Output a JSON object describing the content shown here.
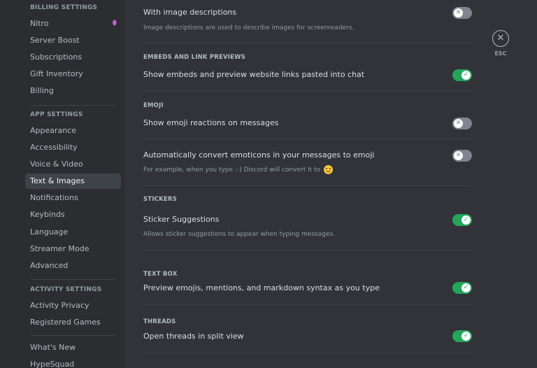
{
  "sidebar": {
    "billing_header": "Billing Settings",
    "billing_items": [
      "Nitro",
      "Server Boost",
      "Subscriptions",
      "Gift Inventory",
      "Billing"
    ],
    "app_header": "App Settings",
    "app_items": [
      "Appearance",
      "Accessibility",
      "Voice & Video",
      "Text & Images",
      "Notifications",
      "Keybinds",
      "Language",
      "Streamer Mode",
      "Advanced"
    ],
    "active_item": "Text & Images",
    "activity_header": "Activity Settings",
    "activity_items": [
      "Activity Privacy",
      "Registered Games"
    ],
    "misc_items": [
      "What's New",
      "HypeSquad"
    ]
  },
  "settings": {
    "image_desc_title": "With image descriptions",
    "image_desc_desc": "Image descriptions are used to describe images for screenreaders.",
    "image_desc_state": "off",
    "embeds_header": "Embeds and Link Previews",
    "embeds_title": "Show embeds and preview website links pasted into chat",
    "embeds_state": "on",
    "emoji_header": "Emoji",
    "emoji_reactions_title": "Show emoji reactions on messages",
    "emoji_reactions_state": "off",
    "emoticons_title": "Automatically convert emoticons in your messages to emoji",
    "emoticons_desc": "For example, when you type :-) Discord will convert it to",
    "emoticons_state": "off",
    "stickers_header": "Stickers",
    "sticker_suggestions_title": "Sticker Suggestions",
    "sticker_suggestions_desc": "Allows sticker suggestions to appear when typing messages.",
    "sticker_suggestions_state": "on",
    "textbox_header": "Text Box",
    "textbox_title": "Preview emojis, mentions, and markdown syntax as you type",
    "textbox_state": "on",
    "threads_header": "Threads",
    "threads_title": "Open threads in split view",
    "threads_state": "on"
  },
  "esc": {
    "label": "ESC"
  },
  "colors": {
    "toggle_on": "#23a55a",
    "toggle_off": "#80848e",
    "nitro": "#c95fd8"
  }
}
